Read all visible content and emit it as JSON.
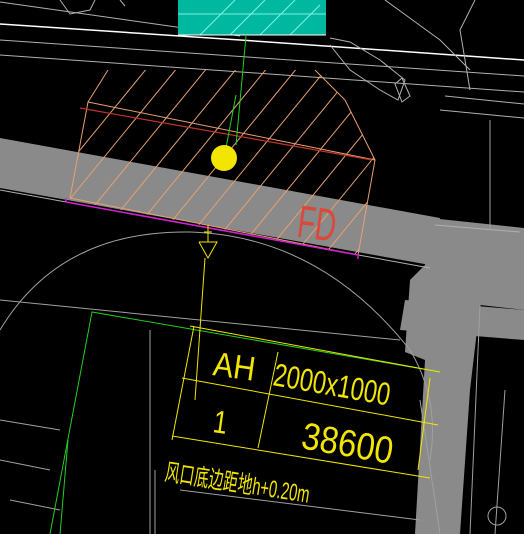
{
  "drawing": {
    "background": "#000000",
    "colors": {
      "wall": "#8a8a8a",
      "outline": "#e8a070",
      "hatch": "#e8a070",
      "red_line": "#c0342a",
      "magenta_line": "#d020d0",
      "yellow": "#f2e600",
      "green": "#22d022",
      "gray_line": "#b0b0b0",
      "cyan": "#00b8a0",
      "white_line": "#ffffff"
    },
    "marker_symbol": "yellow-circle-marker",
    "arrow_symbol": "down-arrow-icon",
    "fd_label": "FD",
    "table": {
      "row1_col1": "AH",
      "row1_col2": "2000x1000",
      "row2_col1": "1",
      "row2_col2": "38600",
      "note": "风口底边距地h+0.20m"
    }
  }
}
